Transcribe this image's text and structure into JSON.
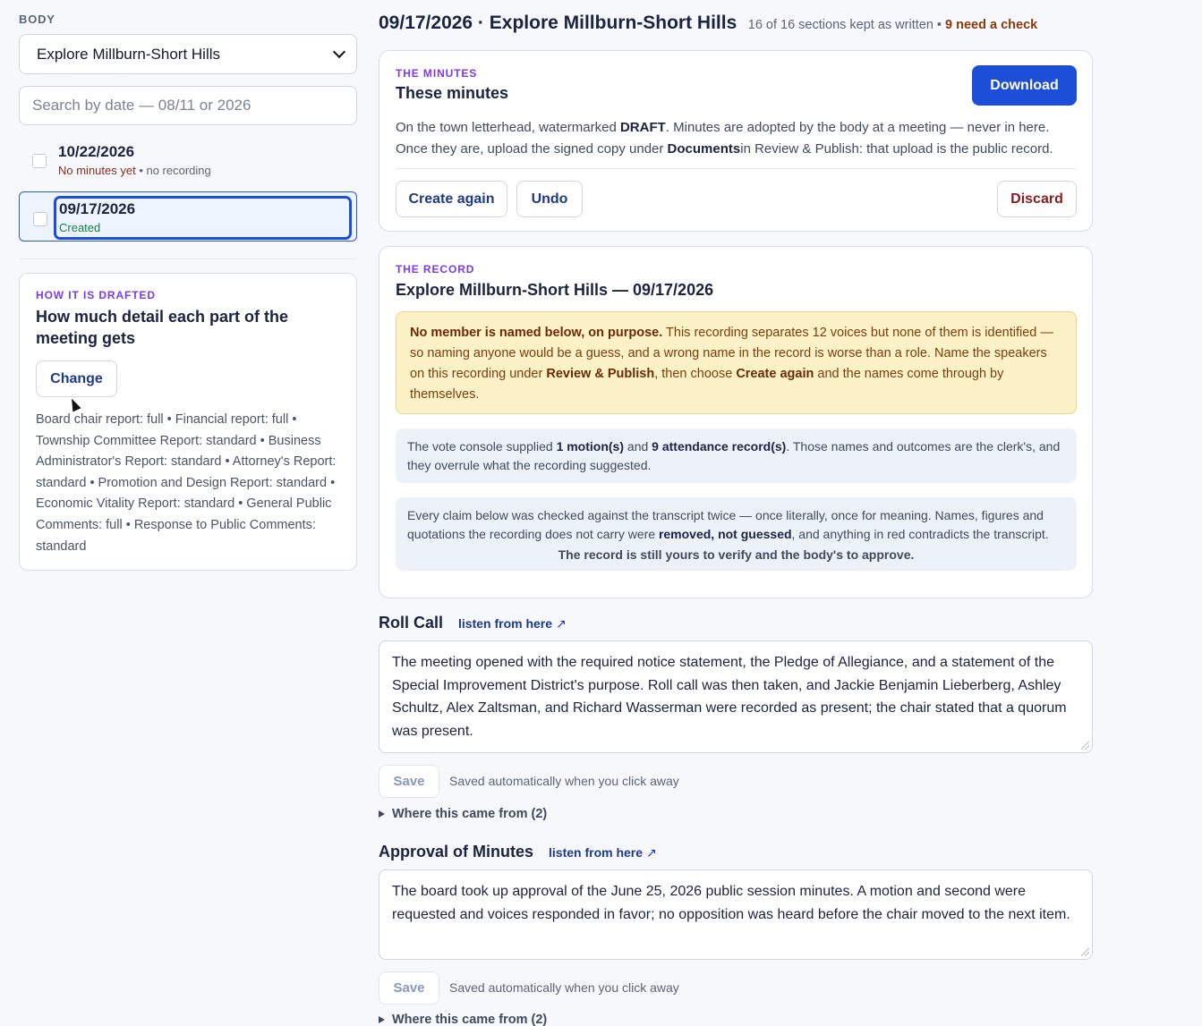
{
  "sidebar": {
    "body_label": "BODY",
    "body_select": "Explore Millburn-Short Hills",
    "search_placeholder": "Search by date — 08/11 or 2026",
    "meetings": [
      {
        "date": "10/22/2026",
        "status": "No minutes yet",
        "extra": " • no recording"
      },
      {
        "date": "09/17/2026",
        "status": "Created"
      }
    ],
    "drafting": {
      "kicker": "HOW IT IS DRAFTED",
      "title": "How much detail each part of the meeting gets",
      "change_label": "Change",
      "detail": "Board chair report: full • Financial report: full • Township Committee Report: standard • Business Administrator's Report: standard • Attorney's Report: standard • Promotion and Design Report: standard • Economic Vitality Report: standard • General Public Comments: full • Response to Public Comments: standard"
    }
  },
  "header": {
    "title": "09/17/2026 · Explore Millburn-Short Hills",
    "meta": "16 of 16 sections kept as written •",
    "need_check": "9 need a check"
  },
  "minutes": {
    "kicker": "THE MINUTES",
    "title": "These minutes",
    "download_label": "Download",
    "desc_1": "On the town letterhead, watermarked ",
    "desc_draft": "DRAFT",
    "desc_2": ". Minutes are adopted by the body at a meeting — never in here. Once they are, upload the signed copy under ",
    "desc_documents": "Documents",
    "desc_3": "in Review & Publish: that upload is the public record.",
    "create_again_label": "Create again",
    "undo_label": "Undo",
    "discard_label": "Discard"
  },
  "record": {
    "kicker": "THE RECORD",
    "title": "Explore Millburn-Short Hills — 09/17/2026",
    "warning_bold": "No member is named below, on purpose.",
    "warning_1": " This recording separates 12 voices but none of them is identified — so naming anyone would be a guess, and a wrong name in the record is worse than a role. Name the speakers on this recording under ",
    "warning_review": "Review & Publish",
    "warning_2": ", then choose ",
    "warning_create": "Create again",
    "warning_3": " and the names come through by themselves.",
    "vote_1": "The vote console supplied ",
    "vote_motions": "1 motion(s)",
    "vote_2": " and ",
    "vote_attendance": "9 attendance record(s)",
    "vote_3": ". Those names and outcomes are the clerk's, and they overrule what the recording suggested.",
    "check_1": "Every claim below was checked against the transcript twice — once literally, once for meaning. Names, figures and quotations the recording does not carry were ",
    "check_removed": "removed, not guessed",
    "check_2": ", and anything in red contradicts the transcript.",
    "check_final": "The record is still yours to verify and the body's to approve."
  },
  "sections": [
    {
      "title": "Roll Call",
      "listen_label": "listen from here",
      "text": "The meeting opened with the required notice statement, the Pledge of Allegiance, and a statement of the Special Improvement District's purpose. Roll call was then taken, and Jackie Benjamin Lieberberg, Ashley Schultz, Alex Zaltsman, and Richard Wasserman were recorded as present; the chair stated that a quorum was present.",
      "save_label": "Save",
      "autosave_note": "Saved automatically when you click away",
      "source_label": "Where this came from (2)"
    },
    {
      "title": "Approval of Minutes",
      "listen_label": "listen from here",
      "text": "The board took up approval of the June 25, 2026 public session minutes. A motion and second were requested and voices responded in favor; no opposition was heard before the chair moved to the next item.",
      "save_label": "Save",
      "autosave_note": "Saved automatically when you click away",
      "source_label": "Where this came from (2)"
    }
  ]
}
